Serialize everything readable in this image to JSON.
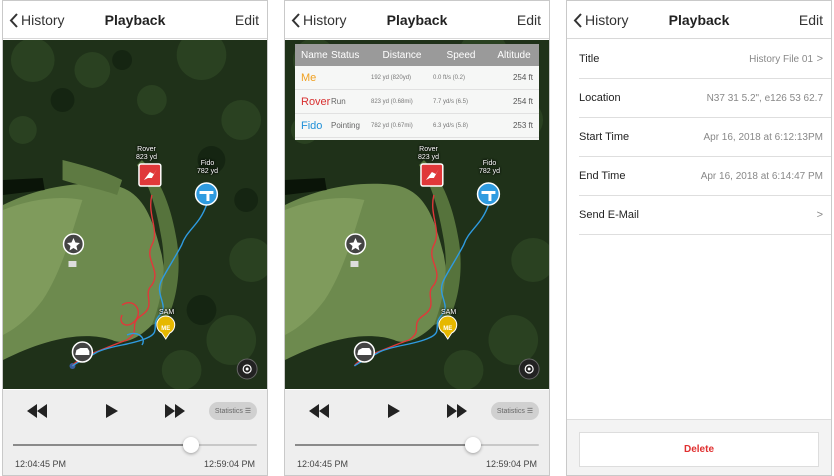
{
  "nav": {
    "back_label": "History",
    "title": "Playback",
    "edit_label": "Edit"
  },
  "map": {
    "rover_label": "Rover",
    "rover_distance": "823 yd",
    "fido_label": "Fido",
    "fido_distance": "782 yd",
    "sam_label": "SAM",
    "me_badge": "ME"
  },
  "stats_table": {
    "headers": [
      "Name",
      "Status",
      "Distance",
      "Speed",
      "Altitude"
    ],
    "rows": [
      {
        "name": "Me",
        "name_color": "#f0a020",
        "status": "",
        "distance": "192 yd (820yd)",
        "speed": "0.0 ft/s (0.2)",
        "altitude": "254 ft"
      },
      {
        "name": "Rover",
        "name_color": "#d83030",
        "status": "Run",
        "distance": "823 yd (0.68mi)",
        "speed": "7.7 yd/s (6.5)",
        "altitude": "254 ft"
      },
      {
        "name": "Fido",
        "name_color": "#2090d8",
        "status": "Pointing",
        "distance": "782 yd (0.67mi)",
        "speed": "6.3 yd/s (5.8)",
        "altitude": "253 ft"
      }
    ]
  },
  "playback": {
    "statistics_label": "Statistics",
    "start_time": "12:04:45 PM",
    "end_time": "12:59:04 PM",
    "progress": 0.73
  },
  "details": {
    "title_label": "Title",
    "title_value": "History File 01",
    "location_label": "Location",
    "location_value": "N37 31 5.2\", e126 53 62.7",
    "start_label": "Start Time",
    "start_value": "Apr 16, 2018 at 6:12:13PM",
    "end_label": "End Time",
    "end_value": "Apr 16, 2018 at 6:14:47 PM",
    "email_label": "Send E-Mail",
    "delete_label": "Delete"
  },
  "colors": {
    "rover": "#e0383a",
    "fido": "#2f9be0",
    "me": "#e6b800",
    "delete": "#e03030"
  }
}
